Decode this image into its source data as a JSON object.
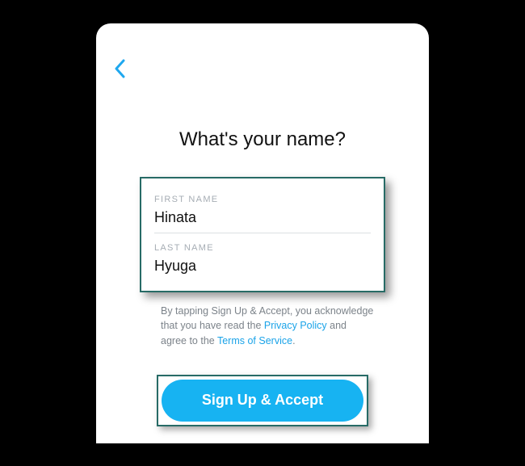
{
  "title": "What's your name?",
  "form": {
    "first_name_label": "FIRST NAME",
    "first_name_value": "Hinata",
    "last_name_label": "LAST NAME",
    "last_name_value": "Hyuga"
  },
  "disclaimer": {
    "part1": "By tapping Sign Up & Accept, you acknowledge that you have read the ",
    "privacy_link": "Privacy Policy",
    "part2": " and agree to the ",
    "tos_link": "Terms of Service",
    "part3": "."
  },
  "signup_button_label": "Sign Up & Accept"
}
